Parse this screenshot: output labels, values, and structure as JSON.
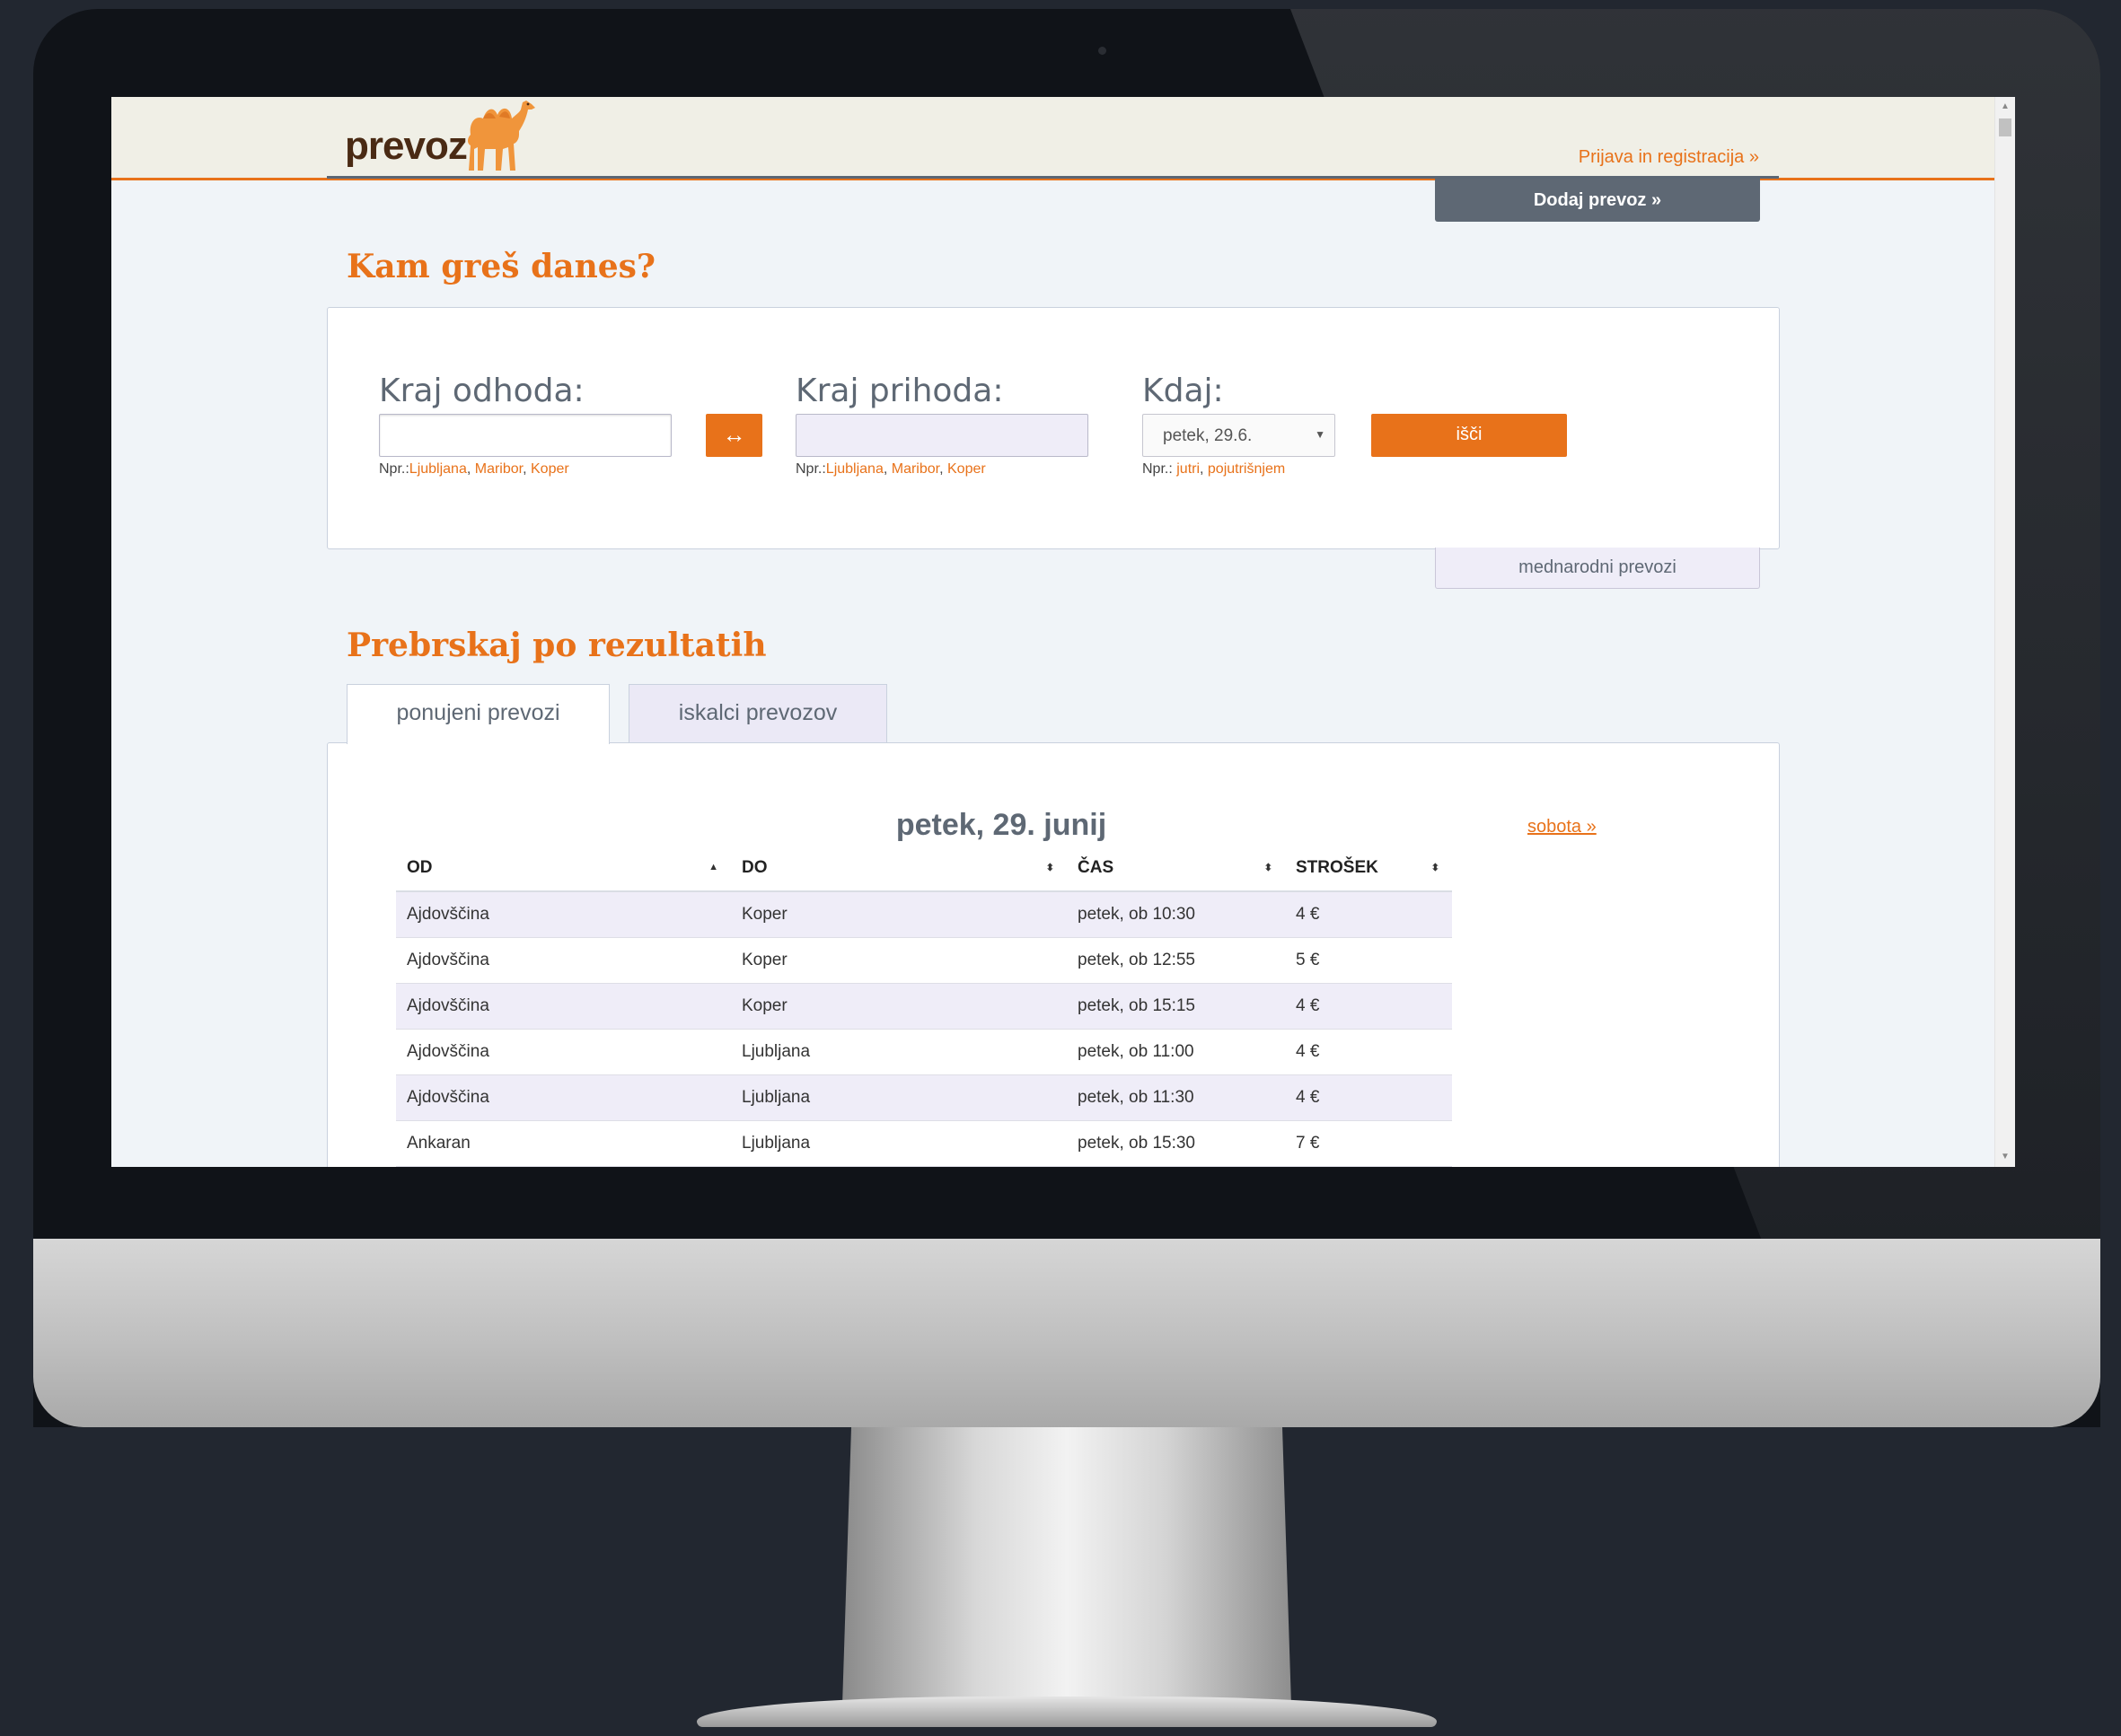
{
  "header": {
    "logo": "prevoz",
    "login_link": "Prijava in registracija »",
    "add_button": "Dodaj prevoz »"
  },
  "search": {
    "heading": "Kam greš danes?",
    "from_label": "Kraj odhoda:",
    "to_label": "Kraj prihoda:",
    "when_label": "Kdaj:",
    "from_value": "",
    "to_value": "",
    "swap_icon": "↔",
    "date_selected": "petek, 29.6.",
    "search_button": "išči",
    "hint_prefix": "Npr.:",
    "hint_when_prefix": "Npr.: ",
    "from_examples": [
      "Ljubljana",
      "Maribor",
      "Koper"
    ],
    "to_examples": [
      "Ljubljana",
      "Maribor",
      "Koper"
    ],
    "when_examples": [
      "jutri",
      "pojutrišnjem"
    ],
    "separator": ", "
  },
  "international_button": "mednarodni prevozi",
  "results": {
    "heading": "Prebrskaj po rezultatih",
    "tabs": [
      "ponujeni prevozi",
      "iskalci prevozov"
    ],
    "active_tab": 0,
    "date_title": "petek, 29. junij",
    "next_day_link": "sobota »",
    "columns": [
      "OD",
      "DO",
      "ČAS",
      "STROŠEK"
    ],
    "rows": [
      {
        "from": "Ajdovščina",
        "to": "Koper",
        "time": "petek, ob 10:30",
        "cost": "4 €"
      },
      {
        "from": "Ajdovščina",
        "to": "Koper",
        "time": "petek, ob 12:55",
        "cost": "5 €"
      },
      {
        "from": "Ajdovščina",
        "to": "Koper",
        "time": "petek, ob 15:15",
        "cost": "4 €"
      },
      {
        "from": "Ajdovščina",
        "to": "Ljubljana",
        "time": "petek, ob 11:00",
        "cost": "4 €"
      },
      {
        "from": "Ajdovščina",
        "to": "Ljubljana",
        "time": "petek, ob 11:30",
        "cost": "4 €"
      },
      {
        "from": "Ankaran",
        "to": "Ljubljana",
        "time": "petek, ob 15:30",
        "cost": "7 €"
      }
    ]
  },
  "colors": {
    "accent": "#e8721a",
    "slate": "#5e6874",
    "lavender": "#efedf8",
    "page_bg": "#f0f4f8"
  }
}
